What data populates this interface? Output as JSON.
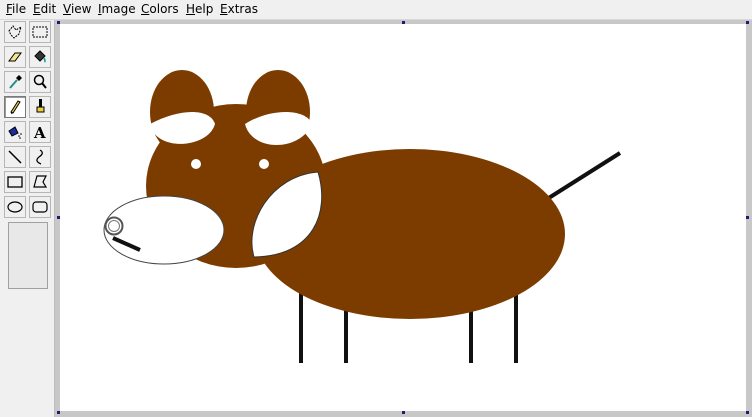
{
  "menu": {
    "items": [
      {
        "id": "file",
        "accel": "F",
        "rest": "ile"
      },
      {
        "id": "edit",
        "accel": "E",
        "rest": "dit"
      },
      {
        "id": "view",
        "accel": "V",
        "rest": "iew"
      },
      {
        "id": "image",
        "accel": "I",
        "rest": "mage"
      },
      {
        "id": "colors",
        "accel": "C",
        "rest": "olors"
      },
      {
        "id": "help",
        "accel": "H",
        "rest": "elp"
      },
      {
        "id": "extras",
        "accel": "E",
        "rest": "xtras"
      }
    ]
  },
  "toolbox": {
    "tools": [
      {
        "name": "free-form-select-icon"
      },
      {
        "name": "rectangle-select-icon"
      },
      {
        "name": "eraser-icon"
      },
      {
        "name": "fill-bucket-icon"
      },
      {
        "name": "color-picker-icon"
      },
      {
        "name": "magnifier-icon"
      },
      {
        "name": "pencil-icon",
        "selected": true
      },
      {
        "name": "brush-icon"
      },
      {
        "name": "airbrush-icon"
      },
      {
        "name": "text-icon",
        "glyph": "A"
      },
      {
        "name": "line-icon"
      },
      {
        "name": "curve-icon"
      },
      {
        "name": "rectangle-icon"
      },
      {
        "name": "polygon-icon"
      },
      {
        "name": "ellipse-icon"
      },
      {
        "name": "rounded-rectangle-icon"
      }
    ]
  },
  "colors": {
    "brown": "#7c3c00",
    "stroke": "#111111",
    "face": "#ffffff",
    "handles": "#1c1c7a"
  }
}
